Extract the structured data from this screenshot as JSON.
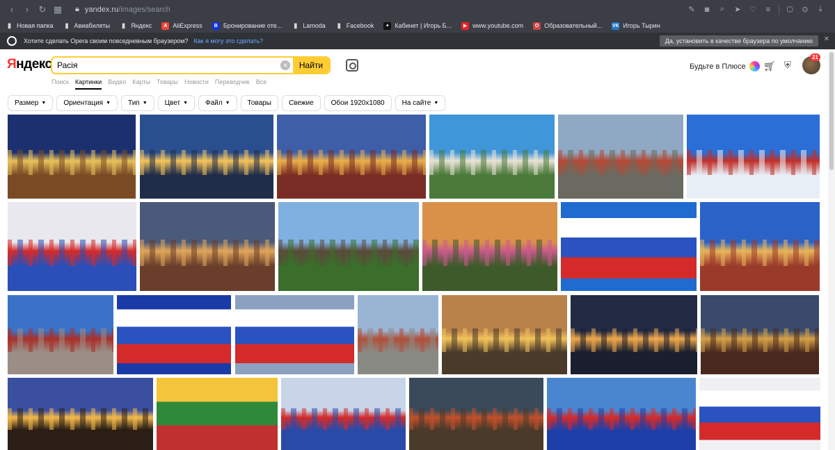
{
  "browser": {
    "url_host": "yandex.ru",
    "url_path": "/images/search"
  },
  "bookmarks": [
    {
      "label": "Новая папка",
      "color": "#d8d8d8",
      "glyph": "▬"
    },
    {
      "label": "Авиабилеты",
      "color": "#d8d8d8",
      "glyph": "▬"
    },
    {
      "label": "Яндекс",
      "color": "#d8d8d8",
      "glyph": "▬"
    },
    {
      "label": "AliExpress",
      "color": "#e43",
      "glyph": "A"
    },
    {
      "label": "Бронирование оте...",
      "color": "#13d",
      "glyph": "B"
    },
    {
      "label": "Lamoda",
      "color": "#d8d8d8",
      "glyph": "▬"
    },
    {
      "label": "Facebook",
      "color": "#d8d8d8",
      "glyph": "▬"
    },
    {
      "label": "Кабинет | Игорь Б...",
      "color": "#111",
      "glyph": "✦"
    },
    {
      "label": "www.youtube.com",
      "color": "#e22",
      "glyph": "▶"
    },
    {
      "label": "Образовательный...",
      "color": "#c44",
      "glyph": "O"
    },
    {
      "label": "Игорь Тырин",
      "color": "#27c",
      "glyph": "VK"
    }
  ],
  "opera_bar": {
    "message": "Хотите сделать Opera своим повседневным браузером?",
    "link": "Как я могу это сделать?",
    "button": "Да, установить в качестве браузера по умолчанию",
    "close": "✕"
  },
  "header": {
    "logo_first": "Я",
    "logo_rest": "ндекс",
    "search_value": "Расія",
    "search_button": "Найти",
    "clear": "✕",
    "plus_label": "Будьте в Плюсе",
    "notifications": "21"
  },
  "tabs": [
    "Поиск",
    "Картинки",
    "Видео",
    "Карты",
    "Товары",
    "Новости",
    "Переводчик",
    "Все"
  ],
  "active_tab": 1,
  "filters": [
    {
      "label": "Размер",
      "dropdown": true
    },
    {
      "label": "Ориентация",
      "dropdown": true
    },
    {
      "label": "Тип",
      "dropdown": true
    },
    {
      "label": "Цвет",
      "dropdown": true
    },
    {
      "label": "Файл",
      "dropdown": true
    },
    {
      "label": "Товары",
      "dropdown": false
    },
    {
      "label": "Свежие",
      "dropdown": false
    },
    {
      "label": "Обои 1920x1080",
      "dropdown": false
    },
    {
      "label": "На сайте",
      "dropdown": true
    }
  ],
  "results": [
    {
      "subject": "kremlin-night",
      "sky": "#1c2f6e",
      "ground": "#7a4a25",
      "accent": "#e8c15a"
    },
    {
      "subject": "moscow-bridge-evening",
      "sky": "#2a4f8f",
      "ground": "#1f2c4a",
      "accent": "#f4c35a"
    },
    {
      "subject": "red-square-dusk",
      "sky": "#3e5ea8",
      "ground": "#7a2d24",
      "accent": "#e9b04a"
    },
    {
      "subject": "izmailovo-kremlin",
      "sky": "#3f96d8",
      "ground": "#4b7a3a",
      "accent": "#e8e2d4"
    },
    {
      "subject": "kremlin-embankment",
      "sky": "#8fa9c4",
      "ground": "#6b6a60",
      "accent": "#b44a36"
    },
    {
      "subject": "st-basils-winter",
      "sky": "#2b6fd6",
      "ground": "#e8eef5",
      "accent": "#c0302a"
    },
    {
      "subject": "girl-with-flag",
      "sky": "#e8e8ee",
      "ground": "#2a4fb8",
      "accent": "#d42a2a"
    },
    {
      "subject": "st-basils-evening",
      "sky": "#4a5a7a",
      "ground": "#6a3e2a",
      "accent": "#e0a55a"
    },
    {
      "subject": "kizhi-lake",
      "sky": "#7fb0e0",
      "ground": "#3a6e2a",
      "accent": "#5a4a3a"
    },
    {
      "subject": "river-valley-sunset",
      "sky": "#d9914a",
      "ground": "#3d5a2a",
      "accent": "#c85a8a"
    },
    {
      "subject": "russian-flag-sky",
      "sky": "#1f6bd0",
      "ground": "#1f6bd0",
      "accent": "#d42a2a"
    },
    {
      "subject": "st-basils-blue",
      "sky": "#2a62c8",
      "ground": "#9a3a2a",
      "accent": "#e9b45a"
    },
    {
      "subject": "state-museum",
      "sky": "#3a72c8",
      "ground": "#9a8e86",
      "accent": "#a8302a"
    },
    {
      "subject": "flag-wave",
      "sky": "#1a3aa8",
      "ground": "#d42a2a",
      "accent": "#ffffff"
    },
    {
      "subject": "flag-clouds",
      "sky": "#8aa2bf",
      "ground": "#5a6878",
      "accent": "#d42a2a"
    },
    {
      "subject": "red-square-aerial",
      "sky": "#9ab4d4",
      "ground": "#8a8a84",
      "accent": "#b0503a"
    },
    {
      "subject": "kremlin-sunset",
      "sky": "#b9824a",
      "ground": "#4a3a2a",
      "accent": "#f2c25a"
    },
    {
      "subject": "kremlin-lights",
      "sky": "#222a44",
      "ground": "#1a1e2e",
      "accent": "#f0a84a"
    },
    {
      "subject": "red-square-dark",
      "sky": "#3a4a6a",
      "ground": "#4a2a1e",
      "accent": "#d4a048"
    },
    {
      "subject": "kremlin-tower-night",
      "sky": "#3b4fa0",
      "ground": "#2a1e16",
      "accent": "#f4b94a"
    },
    {
      "subject": "lithuania-flag",
      "sky": "#f4c43a",
      "ground": "#c03030",
      "accent": "#2e8a3a"
    },
    {
      "subject": "fans-vpered-rossia",
      "sky": "#c8d4e8",
      "ground": "#2a4aa8",
      "accent": "#d42a2a"
    },
    {
      "subject": "st-basils-hdr",
      "sky": "#3a4a5a",
      "ground": "#4a3a2a",
      "accent": "#c0502a"
    },
    {
      "subject": "woman-flag-cliff",
      "sky": "#4a86d0",
      "ground": "#1f3fa8",
      "accent": "#d42a2a"
    },
    {
      "subject": "flag-silk",
      "sky": "#f0f0f4",
      "ground": "#1a3ab0",
      "accent": "#d42a2a"
    }
  ]
}
